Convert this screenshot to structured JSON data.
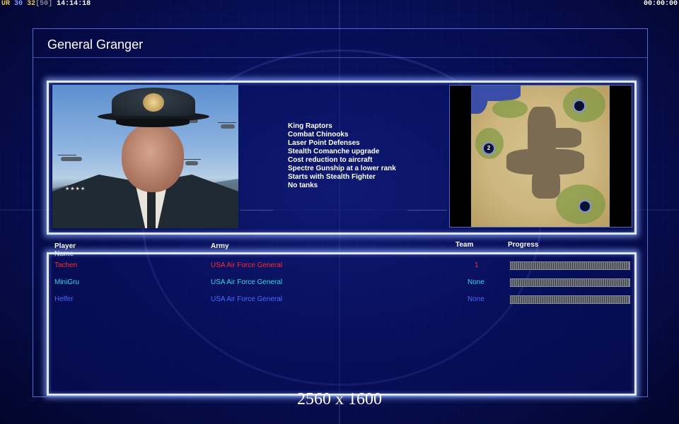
{
  "topbar": {
    "ur_label": "UR",
    "ur_value": "30",
    "frame_value": "32",
    "frame_cap": "[50]",
    "clock": "14:14:18",
    "timer": "00:00:00",
    "colors": {
      "ur": "#e8c84a",
      "value": "#7fa0ff",
      "frame": "#e8c84a",
      "cap": "#8a8a8a",
      "clock": "#ffffff"
    }
  },
  "title": "General Granger",
  "general": {
    "portrait": "general-granger-portrait",
    "features": [
      "King Raptors",
      "Combat Chinooks",
      "Laser Point Defenses",
      "Stealth Comanche upgrade",
      "Cost reduction to aircraft",
      "Spectre Gunship at a lower rank",
      "Starts with Stealth Fighter",
      "No tanks"
    ]
  },
  "map": {
    "start_position_label": "2"
  },
  "columns": {
    "player_name": "Player Name",
    "army": "Army",
    "team": "Team",
    "progress": "Progress"
  },
  "players": [
    {
      "name": "Tachen",
      "army": "USA Air Force General",
      "team": "1",
      "color": "#ff2a2a",
      "progress": 0
    },
    {
      "name": "MiniGru",
      "army": "USA Air Force General",
      "team": "None",
      "color": "#39d7e6",
      "progress": 0
    },
    {
      "name": "Helfer",
      "army": "USA Air Force General",
      "team": "None",
      "color": "#4a6cff",
      "progress": 0
    }
  ],
  "resolution": "2560 x 1600"
}
